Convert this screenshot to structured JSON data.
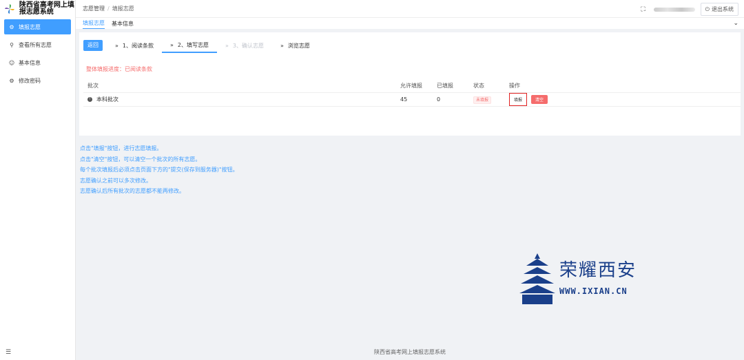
{
  "app": {
    "title": "陕西省高考网上填报志愿系统"
  },
  "sidebar": {
    "items": [
      {
        "label": "填报志愿",
        "icon": "gear-icon",
        "active": true
      },
      {
        "label": "查看所有志愿",
        "icon": "search-icon",
        "active": false
      },
      {
        "label": "基本信息",
        "icon": "user-icon",
        "active": false
      },
      {
        "label": "修改密码",
        "icon": "gear-icon",
        "active": false
      }
    ],
    "collapse_icon": "indent-icon"
  },
  "header": {
    "breadcrumb": [
      "志愿管理",
      "填报志愿"
    ],
    "logout_label": "退出系统"
  },
  "tabs": [
    {
      "label": "填报志愿",
      "active": true
    },
    {
      "label": "基本信息",
      "active": false
    }
  ],
  "steps": {
    "back_label": "返回",
    "items": [
      {
        "label": "1、阅读条款",
        "state": "done"
      },
      {
        "label": "2、填写志愿",
        "state": "active"
      },
      {
        "label": "3、确认志愿",
        "state": "disabled"
      },
      {
        "label": "浏览志愿",
        "state": "normal"
      }
    ]
  },
  "progress_text": "整体填报进度：已阅读条款",
  "table": {
    "headers": [
      "批次",
      "允许填报",
      "已填报",
      "状态",
      "操作"
    ],
    "rows": [
      {
        "batch": "本科批次",
        "allowed": "45",
        "filled": "0",
        "status": "未填报",
        "fill_label": "填报",
        "clear_label": "清空"
      }
    ]
  },
  "notes": [
    "点击\"填报\"按钮，进行志愿填报。",
    "点击\"清空\"按钮，可以清空一个批次的所有志愿。",
    "每个批次填报后必须点击页面下方的\"提交(保存到服务器)\"按钮。",
    "志愿确认之前可以多次修改。",
    "志愿确认后所有批次的志愿都不能再修改。"
  ],
  "footer": "陕西省高考网上填报志愿系统",
  "watermark": {
    "cn": "荣耀西安",
    "en": "WWW.IXIAN.CN"
  },
  "colors": {
    "primary": "#409eff",
    "danger": "#f56c6c",
    "watermark": "#1a3f8a"
  }
}
